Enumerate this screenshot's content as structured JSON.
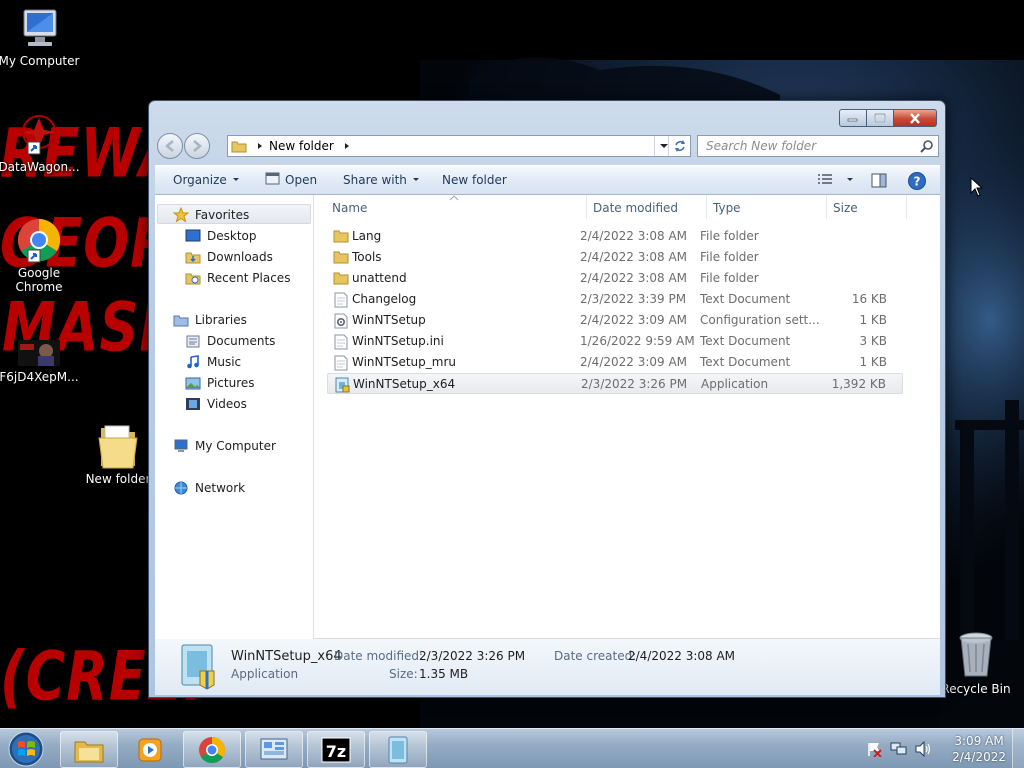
{
  "desktop": {
    "wallpaper_text": {
      "line1": "REWARD",
      "line2": "GEORGE",
      "line3": "MASK",
      "line4": "(CREEP"
    },
    "icons": [
      {
        "label": "My Computer",
        "icon": "computer-icon"
      },
      {
        "label": "DataWagon...",
        "icon": "shortcut-app-icon"
      },
      {
        "label": "Google Chrome",
        "icon": "chrome-icon"
      },
      {
        "label": "F6jD4XepM...",
        "icon": "image-thumbnail-icon"
      },
      {
        "label": "New folder",
        "icon": "folder-icon"
      },
      {
        "label": "Recycle Bin",
        "icon": "recycle-bin-icon"
      }
    ]
  },
  "window": {
    "address": {
      "path": "New folder"
    },
    "search": {
      "placeholder": "Search New folder"
    },
    "toolbar": {
      "organize": "Organize",
      "open": "Open",
      "share_with": "Share with",
      "new_folder": "New folder"
    },
    "nav": {
      "favorites": "Favorites",
      "desktop": "Desktop",
      "downloads": "Downloads",
      "recent_places": "Recent Places",
      "libraries": "Libraries",
      "documents": "Documents",
      "music": "Music",
      "pictures": "Pictures",
      "videos": "Videos",
      "my_computer": "My Computer",
      "network": "Network"
    },
    "columns": {
      "name": "Name",
      "date": "Date modified",
      "type": "Type",
      "size": "Size"
    },
    "files": [
      {
        "name": "Lang",
        "date": "2/4/2022 3:08 AM",
        "type": "File folder",
        "size": "",
        "icon": "folder-icon"
      },
      {
        "name": "Tools",
        "date": "2/4/2022 3:08 AM",
        "type": "File folder",
        "size": "",
        "icon": "folder-icon"
      },
      {
        "name": "unattend",
        "date": "2/4/2022 3:08 AM",
        "type": "File folder",
        "size": "",
        "icon": "folder-icon"
      },
      {
        "name": "Changelog",
        "date": "2/3/2022 3:39 PM",
        "type": "Text Document",
        "size": "16 KB",
        "icon": "text-file-icon"
      },
      {
        "name": "WinNTSetup",
        "date": "2/4/2022 3:09 AM",
        "type": "Configuration sett...",
        "size": "1 KB",
        "icon": "config-file-icon"
      },
      {
        "name": "WinNTSetup.ini",
        "date": "1/26/2022 9:59 AM",
        "type": "Text Document",
        "size": "3 KB",
        "icon": "text-file-icon"
      },
      {
        "name": "WinNTSetup_mru",
        "date": "2/4/2022 3:09 AM",
        "type": "Text Document",
        "size": "1 KB",
        "icon": "text-file-icon"
      },
      {
        "name": "WinNTSetup_x64",
        "date": "2/3/2022 3:26 PM",
        "type": "Application",
        "size": "1,392 KB",
        "icon": "application-icon"
      }
    ],
    "details": {
      "name": "WinNTSetup_x64",
      "kind": "Application",
      "date_modified_label": "Date modified:",
      "date_modified": "2/3/2022 3:26 PM",
      "date_created_label": "Date created:",
      "date_created": "2/4/2022 3:08 AM",
      "size_label": "Size:",
      "size": "1.35 MB"
    }
  },
  "taskbar": {
    "clock": {
      "time": "3:09 AM",
      "date": "2/4/2022"
    },
    "buttons": [
      "start-orb",
      "windows-explorer",
      "media-player",
      "chrome",
      "control-panel",
      "7zip",
      "winntsetup"
    ]
  },
  "colors": {
    "wallpaper_text": "#c80000",
    "selection": "#e8eaee",
    "link_blue": "#1e395b"
  }
}
